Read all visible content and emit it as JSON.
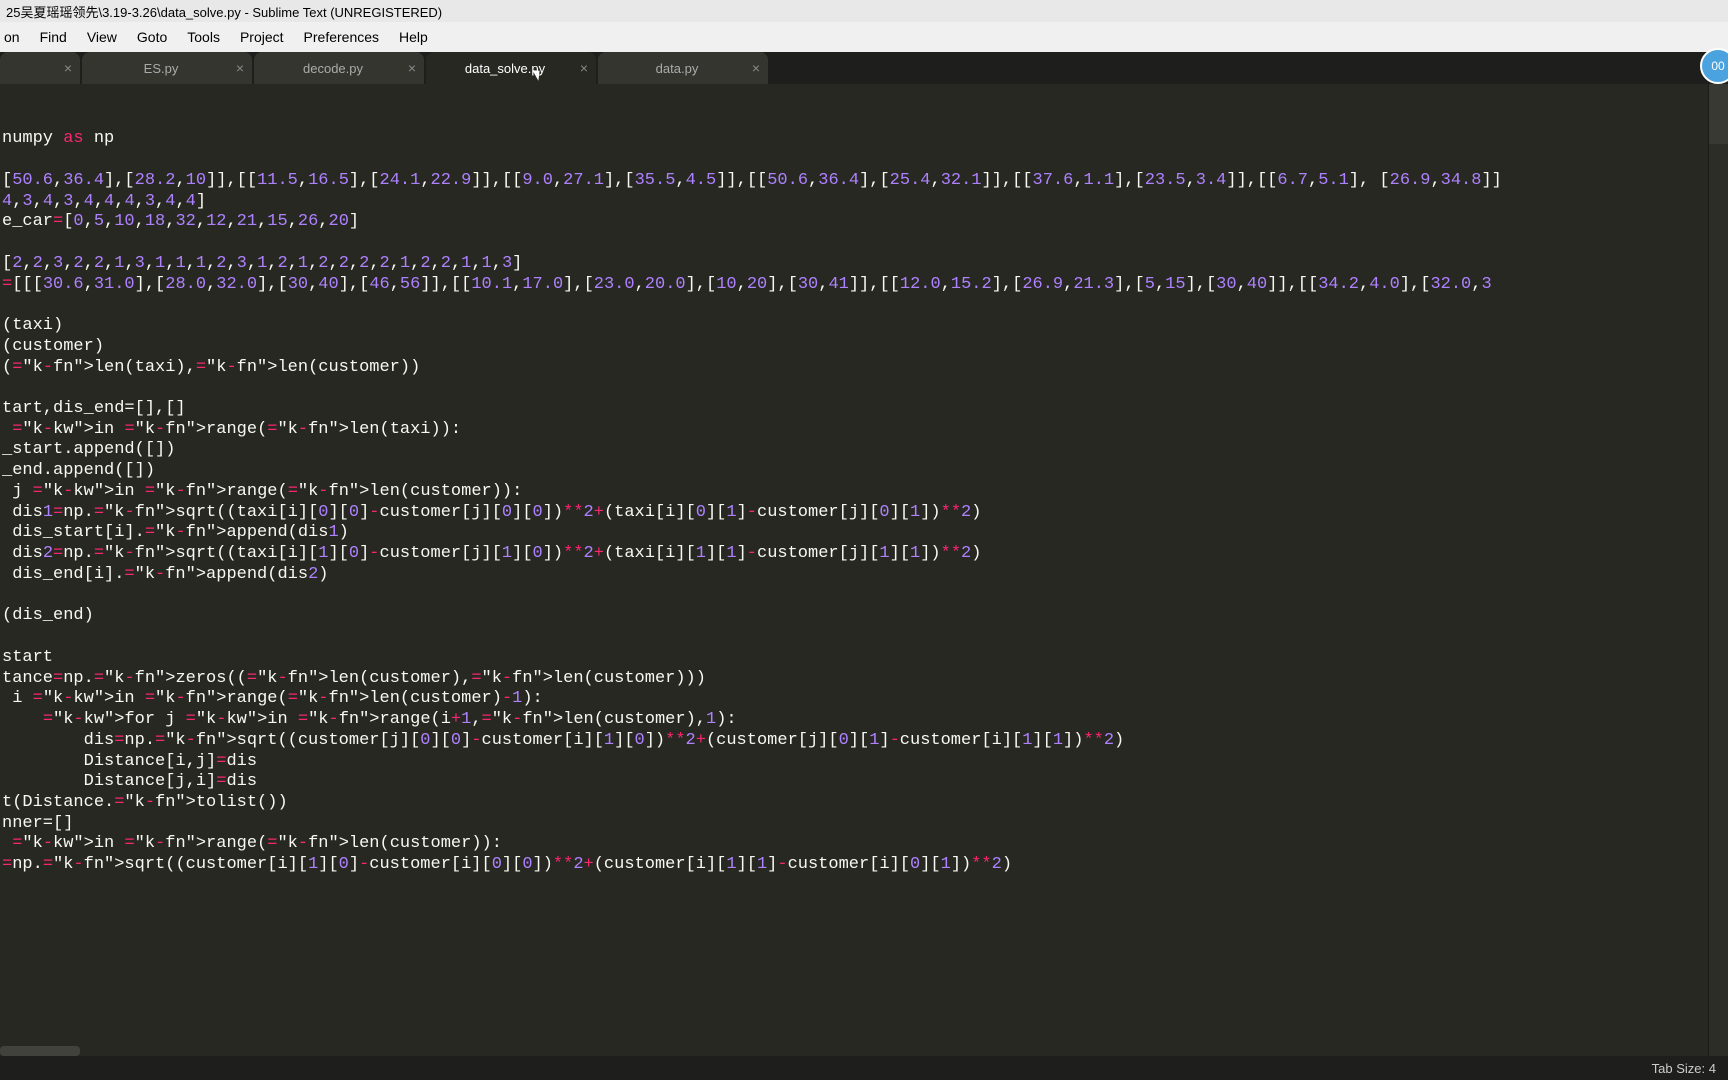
{
  "window": {
    "title": "25吴夏瑶瑶领先\\3.19-3.26\\data_solve.py - Sublime Text (UNREGISTERED)"
  },
  "menu": [
    "on",
    "Find",
    "View",
    "Goto",
    "Tools",
    "Project",
    "Preferences",
    "Help"
  ],
  "tabs": [
    {
      "label": "",
      "active": false,
      "empty": true
    },
    {
      "label": "ES.py",
      "active": false
    },
    {
      "label": "decode.py",
      "active": false
    },
    {
      "label": "data_solve.py",
      "active": true
    },
    {
      "label": "data.py",
      "active": false
    }
  ],
  "code": {
    "l1_a": "numpy ",
    "l1_b": "as",
    "l1_c": " np",
    "l3": "[50.6,36.4],[28.2,10]],[[11.5,16.5],[24.1,22.9]],[[9.0,27.1],[35.5,4.5]],[[50.6,36.4],[25.4,32.1]],[[37.6,1.1],[23.5,3.4]],[[6.7,5.1], [26.9,34.8]]",
    "l4": "4,3,4,3,4,4,4,3,4,4]",
    "l5_a": "e_car",
    "l5_b": "=[",
    "l5_c": "0,5,10,18,32,12,21,15,26,20",
    "l5_d": "]",
    "l7": "[2,2,3,2,2,1,3,1,1,1,2,3,1,2,1,2,2,2,2,1,2,2,1,1,3]",
    "l8": "=[[[30.6,31.0],[28.0,32.0],[30,40],[46,56]],[[10.1,17.0],[23.0,20.0],[10,20],[30,41]],[[12.0,15.2],[26.9,21.3],[5,15],[30,40]],[[34.2,4.0],[32.0,3",
    "l10": "(taxi)",
    "l11": "(customer)",
    "l12": "(len(taxi),len(customer))",
    "l14": "tart,dis_end=[],[]",
    "l15": " in range(len(taxi)):",
    "l16": "_start.append([])",
    "l17": "_end.append([])",
    "l18": " j in range(len(customer)):",
    "l19": " dis1=np.sqrt((taxi[i][0][0]-customer[j][0][0])**2+(taxi[i][0][1]-customer[j][0][1])**2)",
    "l20": " dis_start[i].append(dis1)",
    "l21": " dis2=np.sqrt((taxi[i][1][0]-customer[j][1][0])**2+(taxi[i][1][1]-customer[j][1][1])**2)",
    "l22": " dis_end[i].append(dis2)",
    "l24": "(dis_end)",
    "l26": "start",
    "l27": "tance=np.zeros((len(customer),len(customer)))",
    "l28": " i in range(len(customer)-1):",
    "l29": "    for j in range(i+1,len(customer),1):",
    "l30": "        dis=np.sqrt((customer[j][0][0]-customer[i][1][0])**2+(customer[j][0][1]-customer[i][1][1])**2)",
    "l31": "        Distance[i,j]=dis",
    "l32": "        Distance[j,i]=dis",
    "l33": "t(Distance.tolist())",
    "l34": "nner=[]",
    "l35": " in range(len(customer)):",
    "l36": "=np.sqrt((customer[i][1][0]-customer[i][0][0])**2+(customer[i][1][1]-customer[i][0][1])**2)"
  },
  "status": {
    "tab_size": "Tab Size: 4"
  },
  "badge": "00"
}
